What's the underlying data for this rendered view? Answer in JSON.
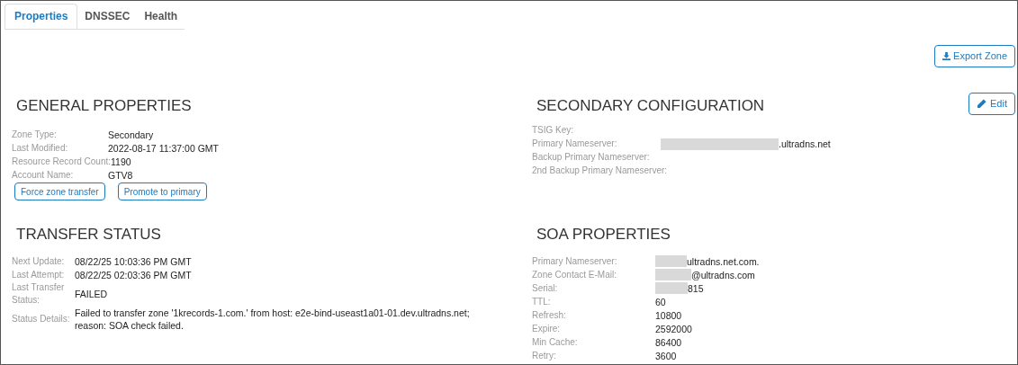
{
  "tabs": [
    {
      "label": "Properties",
      "selected": true
    },
    {
      "label": "DNSSEC",
      "selected": false
    },
    {
      "label": "Health",
      "selected": false
    }
  ],
  "export_button": "Export Zone",
  "general_properties": {
    "title": "GENERAL PROPERTIES",
    "fields": [
      {
        "label": "Zone Type:",
        "value": "Secondary"
      },
      {
        "label": "Last Modified:",
        "value": "2022-08-17 11:37:00 GMT"
      },
      {
        "label": "Resource Record Count:",
        "value": "1190"
      },
      {
        "label": "Account Name:",
        "value": "GTV8"
      }
    ],
    "buttons": [
      "Force zone transfer",
      "Promote to primary"
    ]
  },
  "secondary_configuration": {
    "title": "SECONDARY CONFIGURATION",
    "edit_button": "Edit",
    "fields": [
      {
        "label": "TSIG Key:"
      },
      {
        "label": "Primary Nameserver:",
        "value": ".ultradns.net",
        "redacted": true
      },
      {
        "label": "Backup Primary Nameserver:"
      },
      {
        "label": "2nd Backup Primary Nameserver:"
      }
    ]
  },
  "transfer_status": {
    "title": "TRANSFER STATUS",
    "fields": [
      {
        "label": "Next Update:",
        "value": "08/22/25 10:03:36 PM GMT"
      },
      {
        "label": "Last Attempt:",
        "value": "08/22/25 02:03:36 PM GMT"
      },
      {
        "label": "Last Transfer Status:",
        "value": "FAILED"
      },
      {
        "label": "Status Details:",
        "value": "Failed to transfer zone '1krecords-1.com.' from host: e2e-bind-useast1a01-01.dev.ultradns.net; reason: SOA check failed."
      }
    ]
  },
  "soa_properties": {
    "title": "SOA PROPERTIES",
    "fields": [
      {
        "label": "Primary Nameserver:",
        "value": "ultradns.net.com.",
        "redacted": true
      },
      {
        "label": "Zone Contact E-Mail:",
        "value": "@ultradns.com",
        "redacted": true
      },
      {
        "label": "Serial:",
        "value": "815",
        "redacted": true
      },
      {
        "label": "TTL:",
        "value": "60"
      },
      {
        "label": "Refresh:",
        "value": "10800"
      },
      {
        "label": "Expire:",
        "value": "2592000"
      },
      {
        "label": "Min Cache:",
        "value": "86400"
      },
      {
        "label": "Retry:",
        "value": "3600"
      }
    ]
  }
}
